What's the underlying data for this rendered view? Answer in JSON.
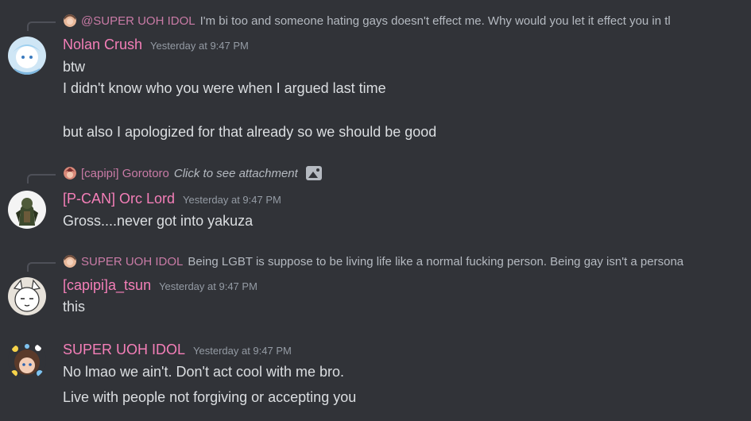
{
  "messages": [
    {
      "reply": {
        "author": "@SUPER UOH IDOL",
        "text": "I'm bi too and someone hating gays doesn't effect me. Why would you let it effect you in tl"
      },
      "author": "Nolan Crush",
      "timestamp": "Yesterday at 9:47 PM",
      "lines": [
        "btw",
        "I didn't know who you were when I argued last time",
        "but also I apologized for that already so we should be good"
      ]
    },
    {
      "reply": {
        "author": "[capipi] Gorotoro",
        "text": "Click to see attachment",
        "icon": "image-icon"
      },
      "author": "[P-CAN] Orc Lord",
      "timestamp": "Yesterday at 9:47 PM",
      "lines": [
        "Gross....never got into yakuza"
      ]
    },
    {
      "reply": {
        "author": "SUPER UOH IDOL",
        "text": "Being LGBT is suppose to be living life like a normal fucking person. Being gay isn't a persona"
      },
      "author": "[capipi]a_tsun",
      "timestamp": "Yesterday at 9:47 PM",
      "lines": [
        "this"
      ]
    },
    {
      "author": "SUPER UOH IDOL",
      "timestamp": "Yesterday at 9:47 PM",
      "lines": [
        "No lmao we ain't. Don't act cool with me bro.",
        "Live with people not forgiving or accepting you"
      ]
    }
  ],
  "colors": {
    "background": "#313338",
    "username": "#f47fb8",
    "reply_username": "#c97ba6",
    "text": "#dbdee1",
    "muted": "#949ba4"
  }
}
